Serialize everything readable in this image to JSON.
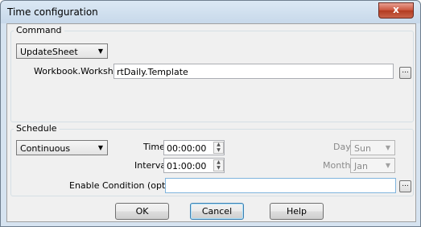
{
  "window": {
    "title": "Time configuration",
    "close_glyph": "x"
  },
  "command": {
    "group_label": "Command",
    "type_value": "UpdateSheet",
    "workbook_label": "Workbook.Worksheet",
    "workbook_value": "rtDaily.Template",
    "browse_label": "..."
  },
  "schedule": {
    "group_label": "Schedule",
    "mode_value": "Continuous",
    "time_label": "Time",
    "time_value": "00:00:00",
    "interval_label": "Interval",
    "interval_value": "01:00:00",
    "day_label": "Day",
    "day_value": "Sun",
    "month_label": "Month",
    "month_value": "Jan",
    "condition_label": "Enable Condition (optional)",
    "condition_value": "",
    "browse_label": "..."
  },
  "buttons": {
    "ok": "OK",
    "cancel": "Cancel",
    "help": "Help"
  },
  "icons": {
    "dropdown": "chevron-down-icon",
    "spin_up": "spin-up-icon",
    "spin_down": "spin-down-icon",
    "close": "close-icon"
  }
}
